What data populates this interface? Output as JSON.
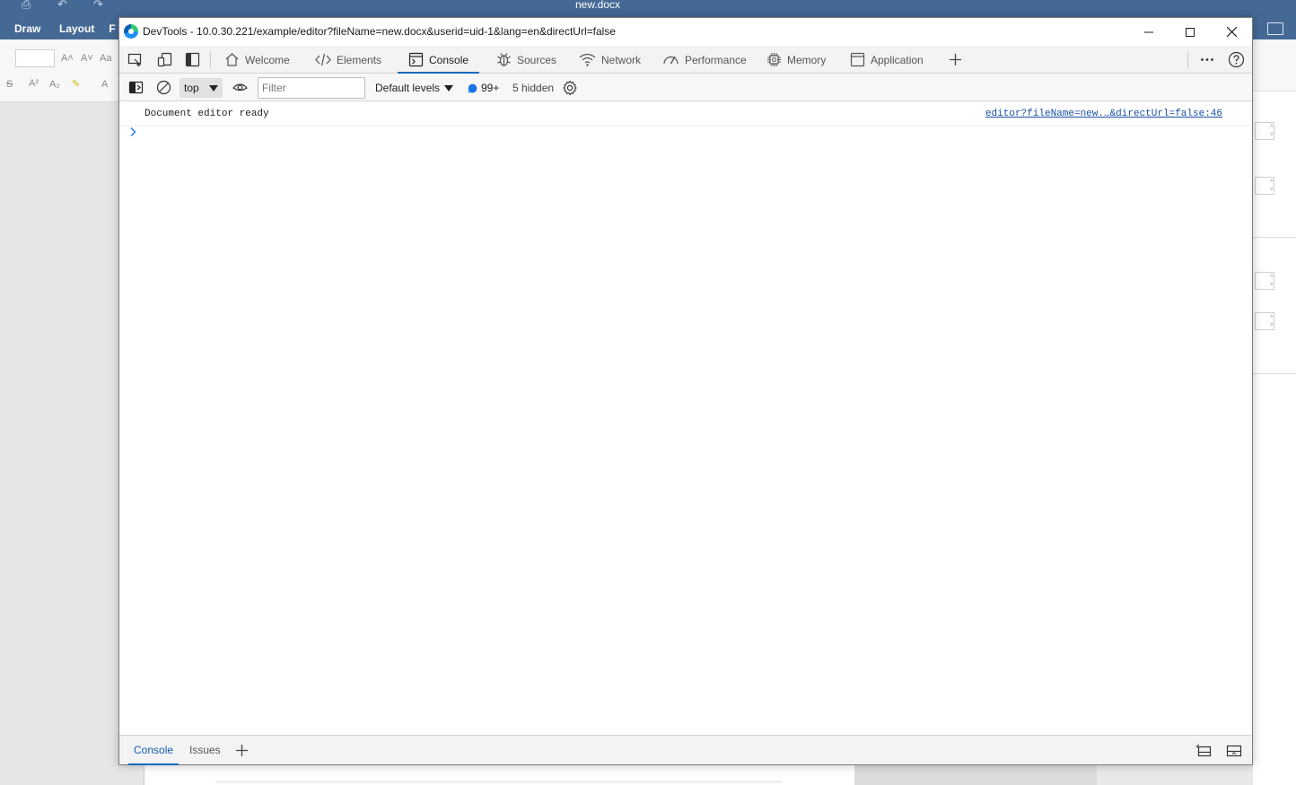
{
  "editor": {
    "doc_title": "new.docx",
    "tabs": [
      "Draw",
      "Layout",
      "F"
    ]
  },
  "devtools": {
    "window_title": "DevTools - 10.0.30.221/example/editor?fileName=new.docx&userid=uid-1&lang=en&directUrl=false",
    "tabs": {
      "welcome": "Welcome",
      "elements": "Elements",
      "console": "Console",
      "sources": "Sources",
      "network": "Network",
      "performance": "Performance",
      "memory": "Memory",
      "application": "Application"
    },
    "console_toolbar": {
      "context": "top",
      "filter_placeholder": "Filter",
      "levels": "Default levels",
      "issues_count": "99+",
      "hidden": "5 hidden"
    },
    "log": {
      "message": "Document editor ready",
      "source": "editor?fileName=new.…&directUrl=false:46"
    },
    "drawer": {
      "console": "Console",
      "issues": "Issues"
    }
  },
  "colors": {
    "editor_header": "#446995",
    "accent": "#0f6cbd",
    "link": "#1a4fa8"
  }
}
